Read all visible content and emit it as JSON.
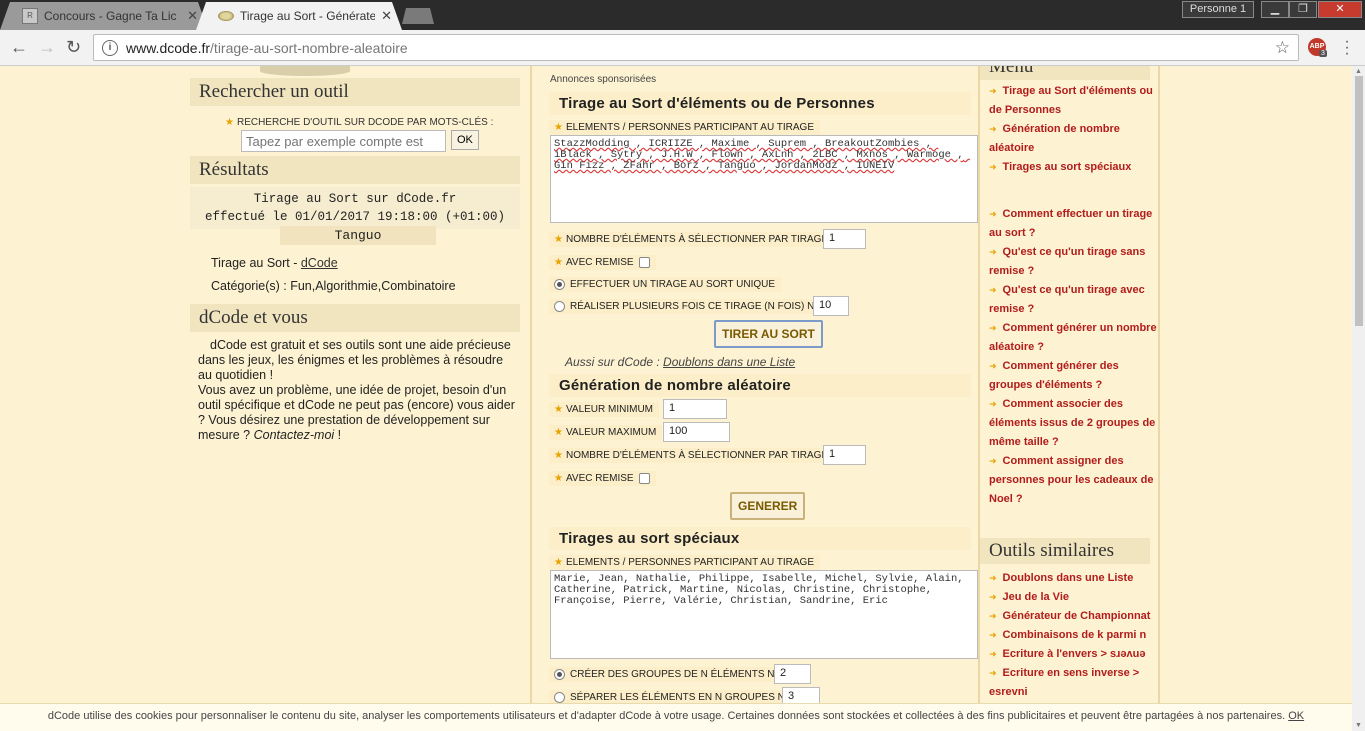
{
  "browser": {
    "tabs": [
      {
        "title": "Concours - Gagne Ta Lic",
        "active": false
      },
      {
        "title": "Tirage au Sort - Générate",
        "active": true
      }
    ],
    "profile": "Personne 1",
    "url_host": "www.dcode.fr",
    "url_path": "/tirage-au-sort-nombre-aleatoire",
    "abp_label": "ABP",
    "abp_count": "3"
  },
  "left": {
    "search_title": "Rechercher un outil",
    "search_label": "RECHERCHE D'OUTIL SUR DCODE PAR MOTS-CLÉS :",
    "search_placeholder": "Tapez par exemple compte est",
    "ok_label": "OK",
    "results_title": "Résultats",
    "result_line1": "Tirage au Sort sur dCode.fr",
    "result_line2": "effectué le 01/01/2017 19:18:00 (+01:00)",
    "result_value": "Tanguo",
    "source_prefix": "Tirage au Sort - ",
    "source_link": "dCode",
    "categories": "Catégorie(s) : Fun,Algorithmie,Combinatoire",
    "you_title": "dCode et vous",
    "you_text1": "dCode est gratuit et ses outils sont une aide précieuse dans les jeux, les énigmes et les problèmes à résoudre au quotidien !",
    "you_text2": "Vous avez un problème, une idée de projet, besoin d'un outil spécifique et dCode ne peut pas (encore) vous aider ? Vous désirez une prestation de développement sur mesure ? ",
    "you_contact": "Contactez-moi",
    "you_end": " !"
  },
  "center": {
    "ads": "Annonces sponsorisées",
    "draw_title": "Tirage au Sort d'éléments ou de Personnes",
    "elements_label": "ELEMENTS / PERSONNES PARTICIPANT AU TIRAGE",
    "elements_text": "StazzModding , ICRIIZE , Maxime , Suprem , BreakoutZombies , iBlack , Sytry , J.H.W , Flown , AxLnh , 2LBC , Mxnos , Warmoge , Gin Fizz , ZFahr , Borz , Tanguo , JordanModz , IUNEIV",
    "count_label": "NOMBRE D'ÉLÉMENTS À SÉLECTIONNER PAR TIRAGE",
    "count_value": "1",
    "replace_label": "AVEC REMISE",
    "single_label": "EFFECTUER UN TIRAGE AU SORT UNIQUE",
    "multi_label": "RÉALISER PLUSIEURS FOIS CE TIRAGE (N FOIS) N=",
    "multi_value": "10",
    "draw_button": "TIRER AU SORT",
    "also_prefix": "Aussi sur dCode : ",
    "also_link": "Doublons dans une Liste",
    "random_title": "Génération de nombre aléatoire",
    "min_label": "VALEUR MINIMUM",
    "min_value": "1",
    "max_label": "VALEUR MAXIMUM",
    "max_value": "100",
    "random_count_label": "NOMBRE D'ÉLÉMENTS À SÉLECTIONNER PAR TIRAGE",
    "random_count_value": "1",
    "random_replace_label": "AVEC REMISE",
    "generate_button": "GENERER",
    "special_title": "Tirages au sort spéciaux",
    "special_label": "ELEMENTS / PERSONNES PARTICIPANT AU TIRAGE",
    "special_text": "Marie, Jean, Nathalie, Philippe, Isabelle, Michel, Sylvie, Alain, Catherine, Patrick, Martine, Nicolas, Christine, Christophe, Françoise, Pierre, Valérie, Christian, Sandrine, Eric",
    "groups_label": "CRÉER DES GROUPES DE N ÉLÉMENTS N=",
    "groups_value": "2",
    "split_label": "SÉPARER LES ÉLÉMENTS EN N GROUPES N=",
    "split_value": "3"
  },
  "right": {
    "menu_title": "Menu",
    "menu_items": [
      "Tirage au Sort d'éléments ou de Personnes",
      "Génération de nombre aléatoire",
      "Tirages au sort spéciaux"
    ],
    "faq_items": [
      "Comment effectuer un tirage au sort ?",
      "Qu'est ce qu'un tirage sans remise ?",
      "Qu'est ce qu'un tirage avec remise ?",
      "Comment générer un nombre aléatoire ?",
      "Comment générer des groupes d'éléments ?",
      "Comment associer des éléments issus de 2 groupes de même taille ?",
      "Comment assigner des personnes pour les cadeaux de Noel ?"
    ],
    "similar_title": "Outils similaires",
    "similar_items": [
      "Doublons dans une Liste",
      "Jeu de la Vie",
      "Générateur de Championnat",
      "Combinaisons de k parmi n",
      "Ecriture à l'envers > sɹǝʌuǝ",
      "Ecriture en sens inverse > esrevni"
    ]
  },
  "cookie": {
    "text": "dCode utilise des cookies pour personnaliser le contenu du site, analyser les comportements utilisateurs et d'adapter dCode à votre usage. Certaines données sont stockées et collectées à des fins publicitaires et peuvent être partagées à nos partenaires. ",
    "ok": "OK"
  },
  "colors": {
    "page_bg": "#fdf3d2",
    "link_red": "#b21c1c",
    "star_orange": "#e8a200"
  }
}
